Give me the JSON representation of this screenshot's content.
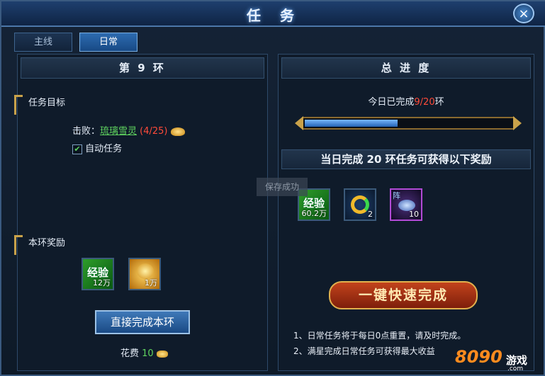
{
  "window": {
    "title": "任 务",
    "close_symbol": "×"
  },
  "tabs": [
    {
      "label": "主线",
      "active": false
    },
    {
      "label": "日常",
      "active": true
    }
  ],
  "left": {
    "header": "第 9 环",
    "goal_title": "任务目标",
    "kill_label": "击败：",
    "kill_target": "琉璃雪灵",
    "kill_progress": "(4/25)",
    "auto_label": "自动任务",
    "auto_checked": true,
    "reward_title": "本环奖励",
    "rewards": [
      {
        "label": "经验",
        "count": "12万"
      },
      {
        "label": "",
        "count": "1万"
      }
    ],
    "finish_button": "直接完成本环",
    "cost_label": "花费",
    "cost_value": "10"
  },
  "right": {
    "header": "总 进 度",
    "done_prefix": "今日已完成",
    "done_value": "9/20",
    "done_suffix": "环",
    "progress_fraction": 0.45,
    "banner": "当日完成 20 环任务可获得以下奖励",
    "rewards": [
      {
        "label": "经验",
        "count": "60.2万"
      },
      {
        "label": "",
        "count": "2"
      },
      {
        "label": "阵",
        "count": "10"
      }
    ],
    "quick_button": "一键快速完成",
    "notes": [
      "1、日常任务将于每日0点重置，请及时完成。",
      "2、满星完成日常任务可获得最大收益"
    ]
  },
  "toast": "保存成功",
  "watermark": {
    "main": "8090",
    "game": "游戏",
    "com": ".com"
  },
  "colors": {
    "accent": "#2d6bb0",
    "highlight": "#ff4b3a",
    "target": "#5fd35f"
  }
}
